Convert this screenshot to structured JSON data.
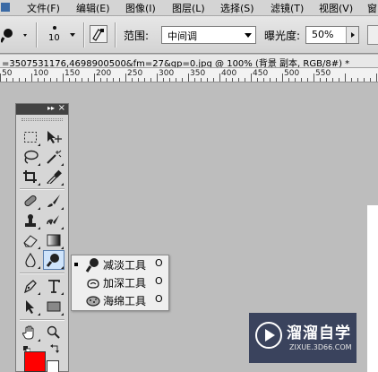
{
  "menu": [
    "文件(F)",
    "编辑(E)",
    "图像(I)",
    "图层(L)",
    "选择(S)",
    "滤镜(T)",
    "视图(V)",
    "窗"
  ],
  "options": {
    "brush_size": "10",
    "range_label": "范围:",
    "range_value": "中间调",
    "exposure_label": "曝光度:",
    "exposure_value": "50%"
  },
  "document": {
    "title": "=3507531176,4698900500&fm=27&gp=0.jpg @ 100% (背景 副本, RGB/8#) *"
  },
  "ruler": [
    "50",
    "100",
    "150",
    "200",
    "250",
    "300",
    "350",
    "400",
    "450",
    "500",
    "550"
  ],
  "flyout": [
    {
      "label": "减淡工具",
      "shortcut": "O",
      "icon": "dodge-icon"
    },
    {
      "label": "加深工具",
      "shortcut": "O",
      "icon": "burn-icon"
    },
    {
      "label": "海绵工具",
      "shortcut": "O",
      "icon": "sponge-icon"
    }
  ],
  "colors": {
    "foreground": "#ff0000",
    "background": "#ffffff"
  },
  "watermark": {
    "title": "溜溜自学",
    "url": "ZIXUE.3D66.COM"
  }
}
